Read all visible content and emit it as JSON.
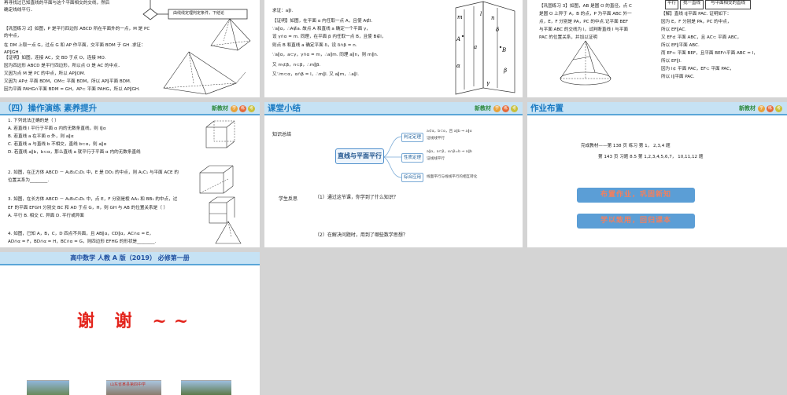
{
  "s1": {
    "lines": [
      "再寻找过已知直线的平面与这个平面相交的交线，然后",
      "确定线线平行．",
      "【巩固练习 2】如图，P 是平行四边形 ABCD 所在平面外的一点，M 是 PC",
      "的中点，",
      "在 DM 上取一点 G，过点 G 和 AP 作平面，交平面 BDM 于 GH .求证：",
      "AP∥GH .",
      "【证明】如图，连接 AC，交 BD 于点 O，连接 MO.",
      "因为四边形 ABCD 是平行四边形，所以点 O 是 AC 的中点．",
      "又因为点 M 是 PC 的中点，所以 AP∥OM.",
      "又因为 AP⊄ 平面 BDM，OM⊂ 平面 BDM，所以 AP∥平面 BDM.",
      "因为平面 PAHG∩平面 BDM = GH，AP⊂ 平面 PAHG，所以 AP∥GH."
    ],
    "flow_label": "由线线定理判定条件，下结论"
  },
  "s2": {
    "lines": [
      "求证：a∥l.",
      "【证明】如图，在平面 α 内任取一点 A，且使 A∉l.",
      "∵a∥α，∴A∉a. 故点 A 和直线 a 确定一个平面 γ，",
      "设 γ∩α = m.    同理，在平面 β 内任取一点 B，且使 B∉l，",
      "则点 B 和直线 a 确定平面 δ，设 δ∩β = n.",
      "∵a∥α，a⊂γ，γ∩α = m，∴a∥m.    同理 a∥n，则 m∥n.",
      "又 m⊄β，n⊂β，∴m∥β.",
      "又∵m⊂α，α∩β = l，∴m∥l. 又 a∥m，∴a∥l."
    ],
    "fig_labels": [
      "m",
      "l",
      "n",
      "A",
      "B",
      "a",
      "α",
      "γ",
      "β",
      "δ"
    ]
  },
  "s3": {
    "table": [
      "平行",
      "找一直线",
      "与平面相交的直线"
    ],
    "lines_left": [
      "【巩固练习 3】如图，AB 是圆 O 的直径，点 C",
      "是圆 O 上异于 A，B 的点，P 为平面 ABC 外一",
      "点，E，F 分别是 PA，PC 的中点.记平面 BEF",
      "与平面 ABC 的交线为 l，试判断直线 l 与平面",
      "PAC 的位置关系，并加以证明"
    ],
    "lines_right": [
      "【解】直线 l∥平面 PAC.  证明如下：",
      "因为 E，F 分别是 PA，PC 的中点，",
      "所以 EF∥AC.",
      "又 EF⊄ 平面 ABC，且 AC⊂ 平面 ABC，",
      "所以 EF∥平面 ABC.",
      "而 EF⊂ 平面 BEF，且平面 BEF∩平面 ABC = l，",
      "所以 EF∥l.",
      "因为 l⊄ 平面 PAC，EF⊂ 平面 PAC，",
      "所以 l∥平面 PAC."
    ]
  },
  "s4": {
    "title": "（四）操作演练 素养提升",
    "brand": "新教材",
    "badges": [
      "学",
      "练",
      "考"
    ],
    "lines": [
      "1. 下列说法正确的是（    ）",
      "A. 若直线 l 平行于平面 α 内的无数条直线，则 l∥α",
      "B. 若直线 a 在平面 α 外，则 a∥α",
      "C. 若直线 a 与直线 b 不相交，直线 b⊂α，则 a∥α",
      "D. 若直线 a∥b，b⊂α，那么直线 a 就平行于平面 α 内的无数条直线",
      "",
      "2. 如图，在正方体 ABCD － A₁B₁C₁D₁ 中，E 是 DD₁ 的中点，则 A₁C₁ 与平面 ACE 的",
      "位置关系为________.",
      "",
      "",
      "3. 如图，在长方体 ABCD － A₁B₁C₁D₁ 中，点 E，F 分别是棱 AA₁ 和 BB₁ 的中点，过",
      "EF 的平面 EFGH 分别交 BC 和 AD 于点 G，H，则 GH 与 AB 的位置关系是（    ）",
      "A. 平行             B. 相交           C. 异面            D. 平行或异面",
      "",
      "4. 如图，已知 A，B，C，D 四点不共面，且 AB∥α，CD∥α，AC∩α = E，",
      "AD∩α = F，BD∩α = H，BC∩α = G，则四边形 EFHG 的形状是________."
    ]
  },
  "s5": {
    "title": "课堂小结",
    "brand": "新教材",
    "badges": [
      "学",
      "练",
      "考"
    ],
    "summary_label": "知识总结",
    "center": "直线与平面平行",
    "branches": [
      "判定定理",
      "性质定理",
      "综合应用"
    ],
    "branch_details": [
      [
        "a⊄α，b⊂α，且 a∥b ⇒ a∥α",
        "证线线平行"
      ],
      [
        "a∥α，a⊂β，α∩β=b ⇒ a∥b",
        "证线线平行"
      ],
      [
        "线面平行与线线平行的相互转化"
      ]
    ],
    "reflect_label": "学生反思",
    "questions": [
      "（1）通过这节课，你学到了什么知识？",
      "（2）在解决问题时，用到了哪些数学思想？"
    ]
  },
  "s6": {
    "title": "作业布置",
    "brand": "新教材",
    "badges": [
      "学",
      "练",
      "考"
    ],
    "hw1": "完成教材——第 138 页  练习     第 1，  2,3,4 题",
    "hw2": "第 143 页  习题 8.5  第 1,2,3,4,5,6,7，  10,11,12 题",
    "banner1": "布置作业，巩固新知",
    "banner2": "学以致用，回归课本"
  },
  "s7": {
    "header": "高中数学    人教 A 版（2019）   必修第一册",
    "thanks": "谢  谢  ~~",
    "school": "山东省某县第四中学"
  }
}
